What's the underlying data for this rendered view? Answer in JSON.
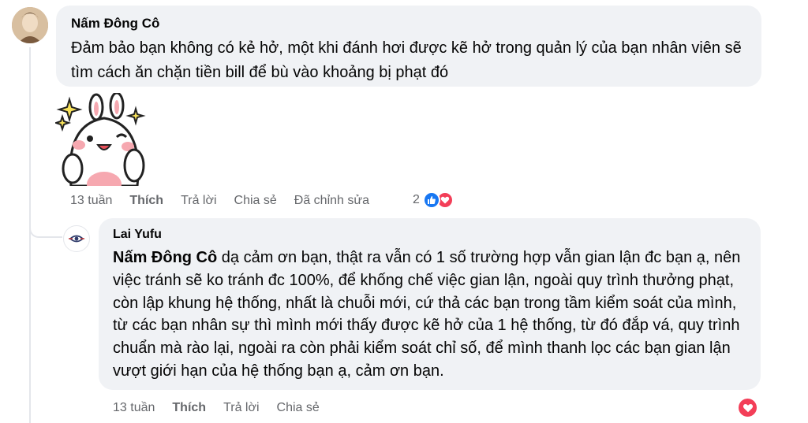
{
  "comment": {
    "author": "Nấm Đông Cô",
    "text": "Đảm bảo bạn không có kẻ hở, một khi đánh hơi được kẽ hở trong quản lý của bạn nhân viên sẽ tìm cách ăn chặn tiền bill để bù vào khoảng bị phạt đó",
    "time": "13 tuần",
    "like_label": "Thích",
    "reply_label": "Trả lời",
    "share_label": "Chia sẻ",
    "edited_label": "Đã chỉnh sửa",
    "reaction_count": "2",
    "reaction_icons": [
      "like-icon",
      "love-icon"
    ],
    "sticker": "bunny-sticker"
  },
  "reply": {
    "author": "Lai Yufu",
    "mention": "Nấm Đông Cô",
    "text": " dạ cảm ơn bạn, thật ra vẫn có 1 số trường hợp vẫn gian lận đc bạn ạ, nên việc tránh sẽ ko tránh đc 100%, để khống chế việc gian lận, ngoài quy trình thưởng phạt, còn lập khung hệ thống, nhất là chuỗi mới, cứ thả các bạn trong tầm kiểm soát của mình, từ các bạn nhân sự thì mình mới thấy được kẽ hở của 1 hệ thống, từ đó đắp vá, quy trình chuẩn mà rào lại, ngoài ra còn phải kiểm soát chỉ số, để mình thanh lọc các bạn gian lận vượt giới hạn của hệ thống bạn ạ, cảm ơn bạn.",
    "time": "13 tuần",
    "like_label": "Thích",
    "reply_label": "Trả lời",
    "share_label": "Chia sẻ",
    "reaction_icons": [
      "love-icon"
    ]
  },
  "colors": {
    "bubble": "#f0f2f5",
    "meta_text": "#65676b",
    "like": "#1877f2",
    "love": "#f33e58"
  }
}
